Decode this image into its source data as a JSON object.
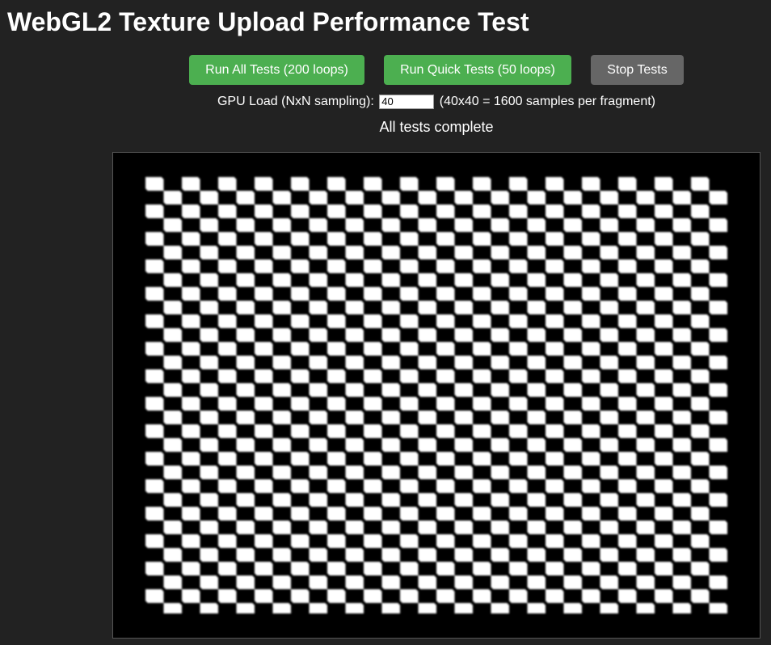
{
  "page": {
    "title": "WebGL2 Texture Upload Performance Test"
  },
  "controls": {
    "run_all_label": "Run All Tests (200 loops)",
    "run_quick_label": "Run Quick Tests (50 loops)",
    "stop_label": "Stop Tests",
    "gpu_load_label": "GPU Load (NxN sampling):",
    "gpu_load_value": "40",
    "gpu_load_note": "(40x40 = 1600 samples per fragment)"
  },
  "status": {
    "text": "All tests complete"
  },
  "colors": {
    "background": "#222222",
    "button_green": "#4caf50",
    "button_gray": "#666666",
    "canvas_bg": "#000000"
  }
}
